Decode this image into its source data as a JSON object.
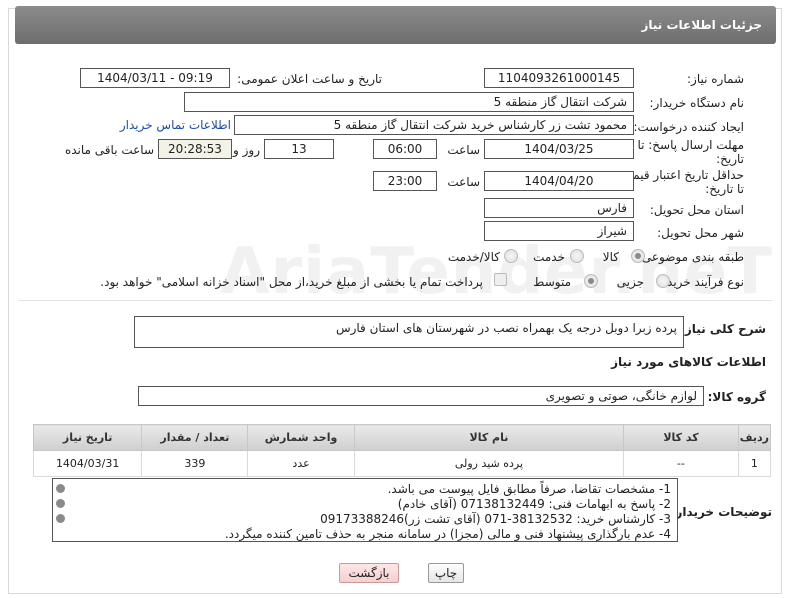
{
  "header": {
    "title": "جزئیات اطلاعات نیاز"
  },
  "fields": {
    "need_number_label": "شماره نیاز:",
    "need_number": "1104093261000145",
    "announce_label": "تاریخ و ساعت اعلان عمومی:",
    "announce_value": "1404/03/11 - 09:19",
    "buyer_org_label": "نام دستگاه خریدار:",
    "buyer_org": "شرکت انتقال گاز منطقه 5",
    "creator_label": "ایجاد کننده درخواست:",
    "creator": "محمود تشت زر کارشناس خرید شرکت انتقال گاز منطقه 5",
    "contact_link": "اطلاعات تماس خریدار",
    "deadline_label_1": "مهلت ارسال پاسخ: تا",
    "deadline_label_2": "تاریخ:",
    "deadline_date": "1404/03/25",
    "time_label": "ساعت",
    "deadline_time": "06:00",
    "days_value": "13",
    "days_label": "روز و",
    "remaining_time": "20:28:53",
    "remaining_label": "ساعت باقی مانده",
    "validity_label_1": "حداقل تاریخ اعتبار قیمت:",
    "validity_label_2": "تا تاریخ:",
    "validity_date": "1404/04/20",
    "validity_time": "23:00",
    "province_label": "استان محل تحویل:",
    "province": "فارس",
    "city_label": "شهر محل تحویل:",
    "city": "شیراز",
    "category_label": "طبقه بندی موضوعی:",
    "category_options": [
      "کالا",
      "خدمت",
      "کالا/خدمت"
    ],
    "process_label": "نوع فرآیند خرید :",
    "process_options": [
      "جزیی",
      "متوسط"
    ],
    "payment_text": "پرداخت تمام یا بخشی از مبلغ خرید،از محل \"اسناد خزانه اسلامی\" خواهد بود.",
    "summary_label": "شرح کلی نیاز:",
    "summary": "پرده زبرا دوبل درجه یک بهمراه نصب در شهرستان های استان فارس",
    "goods_info_title": "اطلاعات کالاهای مورد نیاز",
    "goods_group_label": "گروه کالا:",
    "goods_group": "لوازم خانگی، صوتی و تصویری"
  },
  "table": {
    "headers": [
      "ردیف",
      "کد کالا",
      "نام کالا",
      "واحد شمارش",
      "تعداد / مقدار",
      "تاریخ نیاز"
    ],
    "rows": [
      [
        "1",
        "--",
        "پرده شید رولی",
        "عدد",
        "339",
        "1404/03/31"
      ]
    ]
  },
  "notes": {
    "label": "توضیحات خریدار:",
    "lines": [
      "1-  مشخصات تقاضا، صرفاً مطابق فایل پیوست می باشد.",
      "2- پاسخ به ابهامات فنی: 07138132449 (آقای خادم)",
      "3- کارشناس خرید: 38132532-071 (آقای تشت زر)09173388246",
      "4- عدم بارگذاری پیشنهاد فنی و مالی (مجزا) در سامانه منجر به حذف تامین کننده میگردد."
    ]
  },
  "buttons": {
    "print": "چاپ",
    "back": "بازگشت"
  },
  "watermark": "AriaTender.neT",
  "colors": {
    "header": "#7a7a7a",
    "link": "#1a4fb0",
    "back_button": "#f6cfcf"
  }
}
